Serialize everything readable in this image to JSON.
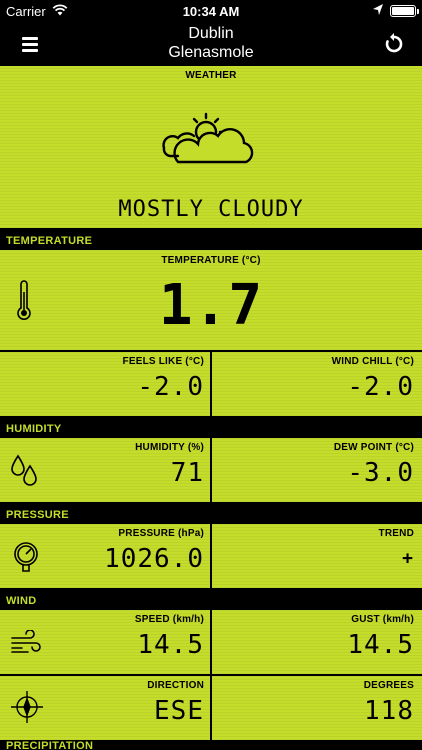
{
  "status_bar": {
    "carrier": "Carrier",
    "time": "10:34 AM"
  },
  "nav": {
    "city": "Dublin",
    "station": "Glenasmole"
  },
  "weather": {
    "label": "WEATHER",
    "condition": "MOSTLY CLOUDY",
    "icon": "partly-cloudy-icon"
  },
  "sections": {
    "temperature": "TEMPERATURE",
    "humidity": "HUMIDITY",
    "pressure": "PRESSURE",
    "wind": "WIND",
    "precipitation": "PRECIPITATION"
  },
  "temperature": {
    "label": "TEMPERATURE (°C)",
    "value": "1.7",
    "feels_like_label": "FEELS LIKE (°C)",
    "feels_like": "-2.0",
    "wind_chill_label": "WIND CHILL (°C)",
    "wind_chill": "-2.0"
  },
  "humidity": {
    "label": "HUMIDITY (%)",
    "value": "71",
    "dew_point_label": "DEW POINT (°C)",
    "dew_point": "-3.0"
  },
  "pressure": {
    "label": "PRESSURE (hPa)",
    "value": "1026.0",
    "trend_label": "TREND",
    "trend": "+"
  },
  "wind": {
    "speed_label": "SPEED (km/h)",
    "speed": "14.5",
    "gust_label": "GUST (km/h)",
    "gust": "14.5",
    "direction_label": "DIRECTION",
    "direction": "ESE",
    "degrees_label": "DEGREES",
    "degrees": "118"
  },
  "colors": {
    "lcd": "#c4dd2b",
    "background": "#000000"
  }
}
